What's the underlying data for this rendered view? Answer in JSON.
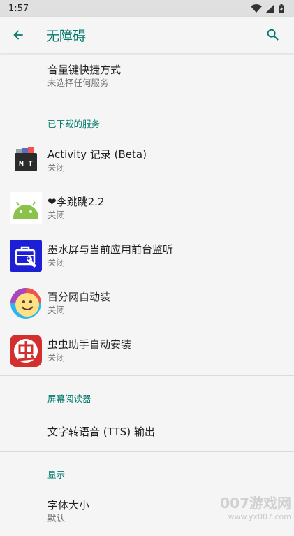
{
  "statusbar": {
    "time": "1:57"
  },
  "appbar": {
    "title": "无障碍"
  },
  "volume_shortcut": {
    "title": "音量键快捷方式",
    "subtitle": "未选择任何服务"
  },
  "downloaded_header": "已下载的服务",
  "services": [
    {
      "title": "Activity 记录 (Beta)",
      "subtitle": "关闭",
      "icon": "mt-icon"
    },
    {
      "title": "❤李跳跳2.2",
      "subtitle": "关闭",
      "icon": "android-icon"
    },
    {
      "title": "墨水屏与当前应用前台监听",
      "subtitle": "关闭",
      "icon": "toolbox-icon"
    },
    {
      "title": "百分网自动装",
      "subtitle": "关闭",
      "icon": "smiley-icon"
    },
    {
      "title": "虫虫助手自动安装",
      "subtitle": "关闭",
      "icon": "chong-icon"
    }
  ],
  "screen_reader_header": "屏幕阅读器",
  "tts": {
    "title": "文字转语音 (TTS) 输出"
  },
  "display_header": "显示",
  "font_size": {
    "title": "字体大小",
    "subtitle": "默认"
  },
  "watermark": {
    "brand": "007游戏网",
    "url": "www.yx007.com"
  },
  "colors": {
    "accent": "#00796b",
    "background": "#f5f5f5"
  }
}
